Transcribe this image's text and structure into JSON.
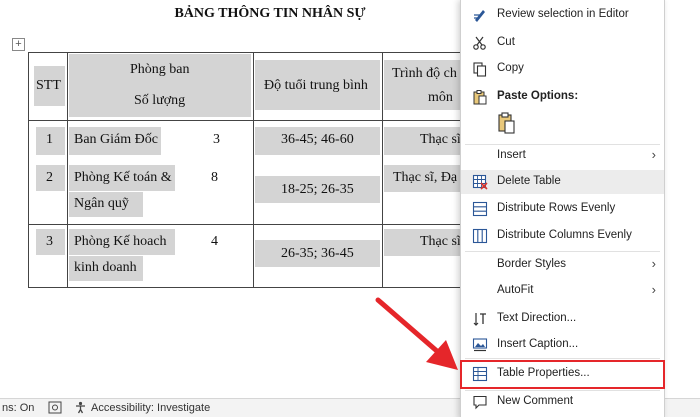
{
  "document": {
    "title": "BẢNG THÔNG TIN NHÂN SỰ",
    "table": {
      "headers": {
        "stt": "STT",
        "dept_line1": "Phòng ban",
        "dept_line2": "Số lượng",
        "age": "Độ tuổi trung bình",
        "edu_line1": "Trình độ ch",
        "edu_line2": "môn"
      },
      "rows": [
        {
          "stt": "1",
          "dept_line1": "Ban Giám Đốc",
          "dept_line2": "",
          "count": "3",
          "age": "36-45; 46-60",
          "edu": "Thạc sĩ"
        },
        {
          "stt": "2",
          "dept_line1": "Phòng Kế toán &",
          "dept_line2": "Ngân quỹ",
          "count": "8",
          "age": "18-25; 26-35",
          "edu": "Thạc sĩ, Đạ"
        },
        {
          "stt": "3",
          "dept_line1": "Phòng Kế hoach",
          "dept_line2": "kinh doanh",
          "count": "4",
          "age": "26-35; 36-45",
          "edu": "Thạc sĩ"
        }
      ]
    }
  },
  "status_bar": {
    "left_text": "ns: On",
    "accessibility": "Accessibility: Investigate"
  },
  "context_menu": {
    "items": [
      {
        "id": "review",
        "label": "Review selection in Editor",
        "icon": "editor-pen-icon"
      },
      {
        "id": "cut",
        "label": "Cut",
        "icon": "scissors-icon"
      },
      {
        "id": "copy",
        "label": "Copy",
        "icon": "copy-icon"
      },
      {
        "id": "paste-options",
        "label": "Paste Options:",
        "icon": "clipboard-icon"
      },
      {
        "id": "insert",
        "label": "Insert",
        "icon": ""
      },
      {
        "id": "delete-table",
        "label": "Delete Table",
        "icon": "delete-table-icon"
      },
      {
        "id": "distribute-rows",
        "label": "Distribute Rows Evenly",
        "icon": "distribute-rows-icon"
      },
      {
        "id": "distribute-cols",
        "label": "Distribute Columns Evenly",
        "icon": "distribute-columns-icon"
      },
      {
        "id": "border-styles",
        "label": "Border Styles",
        "icon": ""
      },
      {
        "id": "autofit",
        "label": "AutoFit",
        "icon": ""
      },
      {
        "id": "text-direction",
        "label": "Text Direction...",
        "icon": "text-direction-icon"
      },
      {
        "id": "insert-caption",
        "label": "Insert Caption...",
        "icon": "caption-icon"
      },
      {
        "id": "table-properties",
        "label": "Table Properties...",
        "icon": "table-properties-icon"
      },
      {
        "id": "new-comment",
        "label": "New Comment",
        "icon": "comment-icon"
      }
    ]
  },
  "colors": {
    "highlight": "#e5262a",
    "arrow": "#e5262a",
    "icon_blue": "#2b5797",
    "cell_shading": "#d4d4d4"
  }
}
